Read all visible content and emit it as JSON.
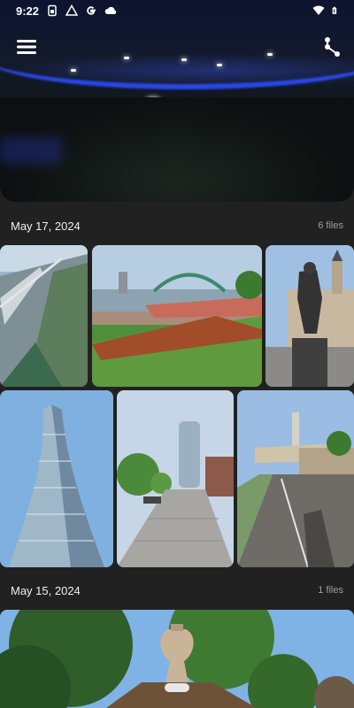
{
  "status_bar": {
    "time": "9:22",
    "left_icons": [
      "sim-icon",
      "drive-icon",
      "google-icon",
      "cloud-icon"
    ],
    "right_icons": [
      "wifi-icon",
      "battery-icon"
    ]
  },
  "header": {
    "menu_icon": "menu-icon",
    "share_icon": "share-icon"
  },
  "sections": [
    {
      "date": "May 17, 2024",
      "count": "6 files",
      "photos": [
        "Bridge walkway",
        "River bridge",
        "Statue",
        "Glass tower",
        "Tower street",
        "Bike path"
      ]
    },
    {
      "date": "May 15, 2024",
      "count": "1 files",
      "photos": [
        "Garden vase"
      ]
    }
  ]
}
